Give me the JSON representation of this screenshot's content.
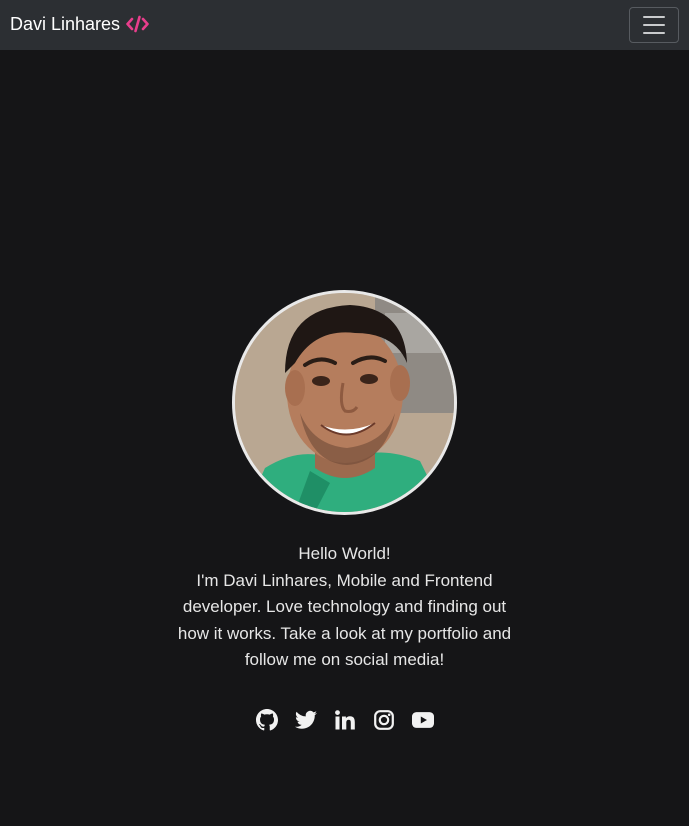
{
  "navbar": {
    "brand_name": "Davi Linhares",
    "brand_icon": "code-icon",
    "brand_accent": "#e83e8c",
    "menu_icon": "hamburger-menu-icon"
  },
  "profile": {
    "photo": "profile-photo"
  },
  "intro": {
    "greeting": "Hello World!",
    "bio": "I'm Davi Linhares, Mobile and Frontend developer. Love technology and finding out how it works. Take a look at my portfolio and follow me on social media!"
  },
  "social": [
    {
      "icon": "github-icon"
    },
    {
      "icon": "twitter-icon"
    },
    {
      "icon": "linkedin-icon"
    },
    {
      "icon": "instagram-icon"
    },
    {
      "icon": "youtube-icon"
    }
  ],
  "colors": {
    "background": "#151517",
    "navbar": "#2c2f33",
    "text": "#e6e6e6",
    "accent": "#e83e8c"
  }
}
